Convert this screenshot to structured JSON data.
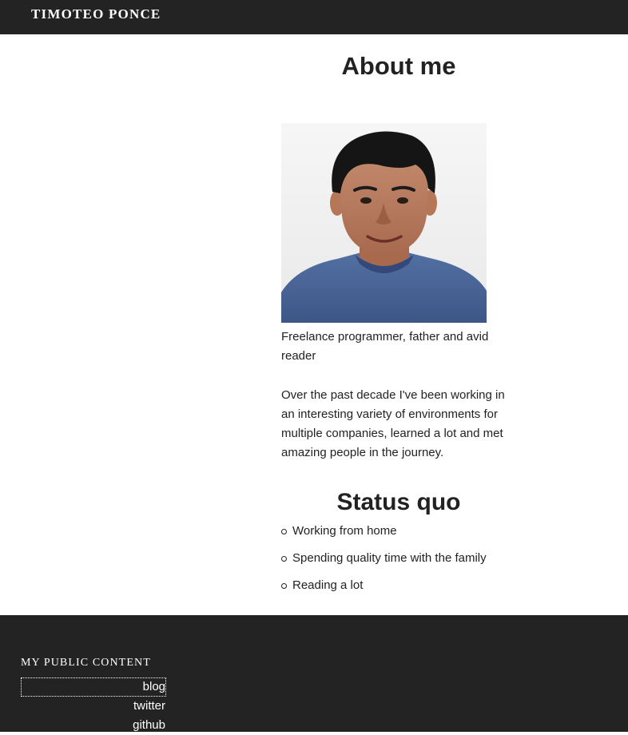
{
  "header": {
    "site_name": "TIMOTEO PONCE"
  },
  "main": {
    "title": "About me",
    "portrait_alt": "Portrait of Timoteo Ponce",
    "intro": "Freelance programmer, father and avid reader",
    "bio": "Over the past decade I've been working in an interesting variety of environments for multiple companies, learned a lot and met amazing people in the journey.",
    "status_title": "Status quo",
    "status_items": [
      "Working from home",
      "Spending quality time with the family",
      "Reading a lot"
    ]
  },
  "footer": {
    "heading": "MY PUBLIC CONTENT",
    "links": [
      {
        "label": "blog",
        "focused": true
      },
      {
        "label": "twitter",
        "focused": false
      },
      {
        "label": "github",
        "focused": false
      }
    ]
  },
  "colors": {
    "bar_background": "#232323",
    "text": "#222222",
    "background": "#ffffff"
  }
}
